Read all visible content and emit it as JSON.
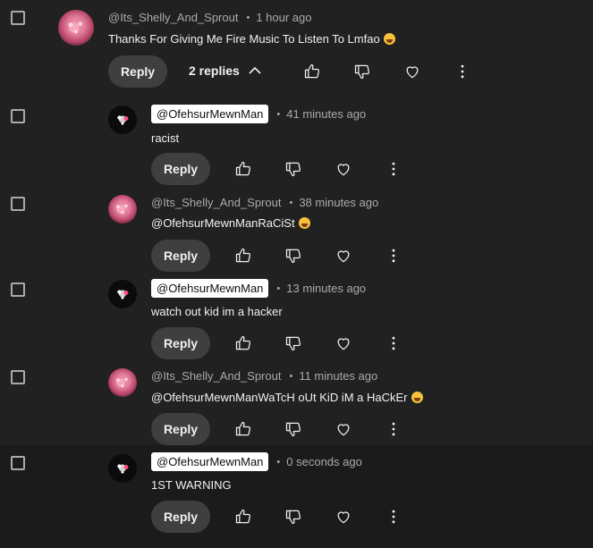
{
  "reply_label": "Reply",
  "top_comment": {
    "author": "@Its_Shelly_And_Sprout",
    "time": "1 hour ago",
    "text": "Thanks For Giving Me Fire Music To Listen To Lmfao",
    "replies_label": "2 replies"
  },
  "replies": [
    {
      "author": "@OfehsurMewnMan",
      "time": "41 minutes ago",
      "text": "racist"
    },
    {
      "author": "@Its_Shelly_And_Sprout",
      "time": "38 minutes ago",
      "text": "@OfehsurMewnManRaCiSt"
    },
    {
      "author": "@OfehsurMewnMan",
      "time": "13 minutes ago",
      "text": "watch out kid im a hacker"
    },
    {
      "author": "@Its_Shelly_And_Sprout",
      "time": "11 minutes ago",
      "text": "@OfehsurMewnManWaTcH oUt KiD iM a HaCkEr"
    },
    {
      "author": "@OfehsurMewnMan",
      "time": "0 seconds ago",
      "text": "1ST WARNING"
    }
  ],
  "colors": {
    "background": "#212121",
    "highlight_row": "#1b1b1b",
    "reply_button": "#3f3f3f",
    "text": "#f1f1f1",
    "meta": "#aaaaaa"
  },
  "icons": [
    "checkbox-icon",
    "thumbs-up-icon",
    "thumbs-down-icon",
    "heart-icon",
    "more-vert-icon",
    "chevron-up-icon",
    "emoji-icon"
  ]
}
